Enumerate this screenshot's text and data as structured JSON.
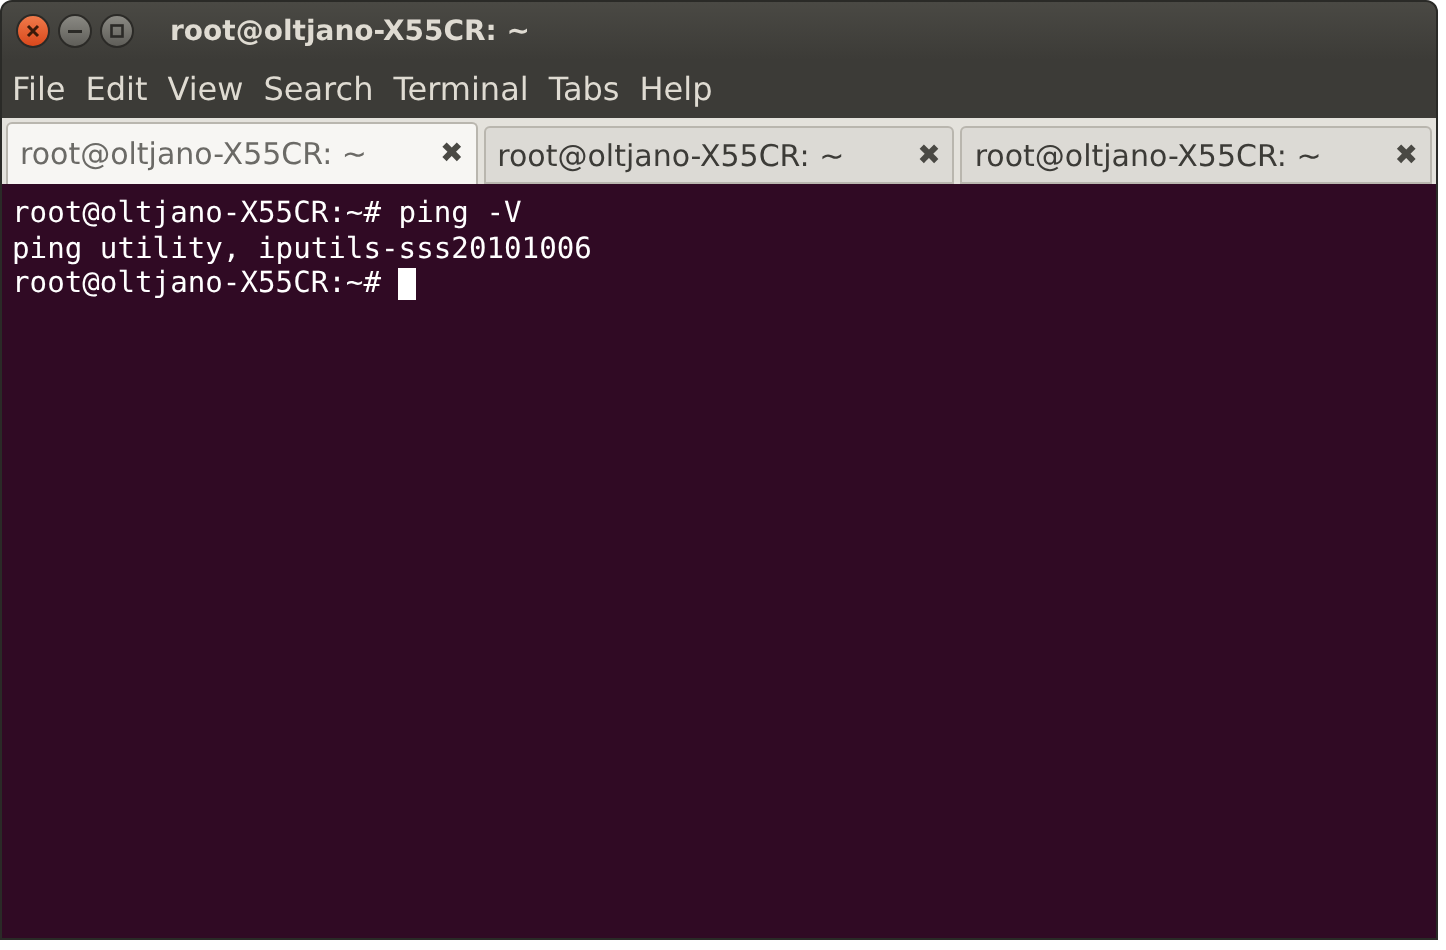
{
  "window": {
    "title": "root@oltjano-X55CR: ~"
  },
  "menu": [
    "File",
    "Edit",
    "View",
    "Search",
    "Terminal",
    "Tabs",
    "Help"
  ],
  "tabs": [
    {
      "label": "root@oltjano-X55CR: ~",
      "selected": true,
      "close": "✖"
    },
    {
      "label": "root@oltjano-X55CR: ~",
      "selected": false,
      "close": "✖"
    },
    {
      "label": "root@oltjano-X55CR: ~",
      "selected": false,
      "close": "✖"
    }
  ],
  "terminal": {
    "lines": [
      "root@oltjano-X55CR:~# ping -V",
      "ping utility, iputils-sss20101006",
      "root@oltjano-X55CR:~# "
    ],
    "cursor": true
  }
}
